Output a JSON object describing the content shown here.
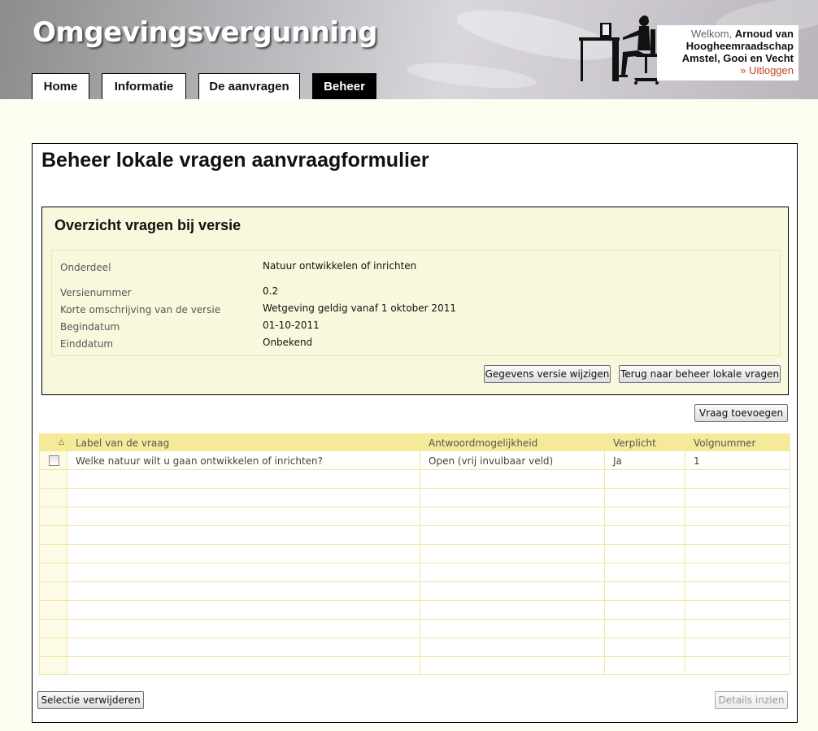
{
  "app_title": "Omgevingsvergunning",
  "nav": {
    "tabs": [
      {
        "label": "Home",
        "active": false
      },
      {
        "label": "Informatie",
        "active": false
      },
      {
        "label": "De aanvragen",
        "active": false
      },
      {
        "label": "Beheer",
        "active": true
      }
    ]
  },
  "user": {
    "welcome_label": "Welkom,",
    "name_line1": "Arnoud van",
    "name_line2": "Hoogheemraadschap",
    "name_line3": "Amstel, Gooi en Vecht",
    "logout": "» Uitloggen"
  },
  "page_title": "Beheer lokale vragen aanvraagformulier",
  "overview": {
    "title": "Overzicht vragen bij versie",
    "fields": [
      {
        "label": "Onderdeel",
        "value": "Natuur ontwikkelen of inrichten"
      },
      {
        "label": "Versienummer",
        "value": "0.2"
      },
      {
        "label": "Korte omschrijving van de versie",
        "value": "Wetgeving geldig vanaf 1 oktober 2011"
      },
      {
        "label": "Begindatum",
        "value": "01-10-2011"
      },
      {
        "label": "Einddatum",
        "value": "Onbekend"
      }
    ],
    "edit_button": "Gegevens versie wijzigen",
    "back_button": "Terug naar beheer lokale vragen"
  },
  "add_question_button": "Vraag toevoegen",
  "table": {
    "columns": [
      "Label van de vraag",
      "Antwoordmogelijkheid",
      "Verplicht",
      "Volgnummer"
    ],
    "rows": [
      {
        "label": "Welke natuur wilt u gaan ontwikkelen of inrichten?",
        "answer": "Open (vrij invulbaar veld)",
        "required": "Ja",
        "order": "1"
      }
    ]
  },
  "delete_selection_button": "Selectie verwijderen",
  "details_button": "Details inzien",
  "colors": {
    "accent": "#000000",
    "header_row": "#f5ea9a",
    "panel_bg": "#f9f8dc",
    "logout": "#c4431f"
  }
}
